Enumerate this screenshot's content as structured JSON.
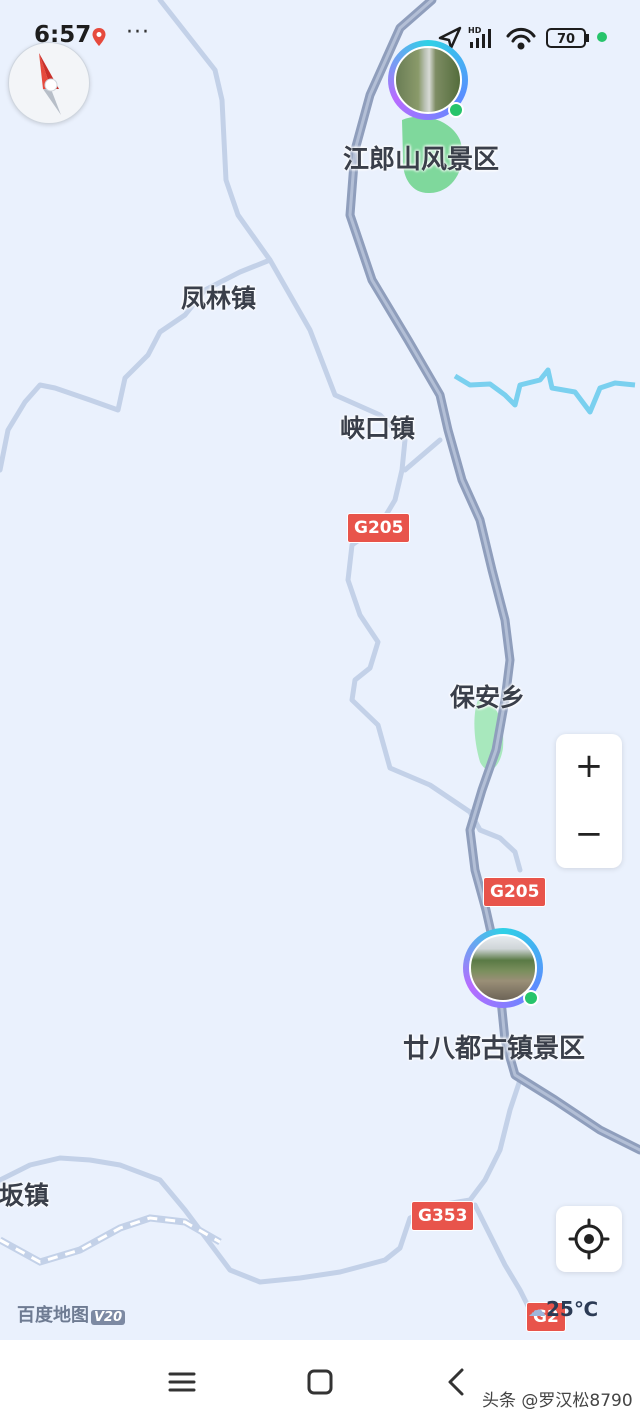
{
  "status_bar": {
    "time": "6:57",
    "more": "···",
    "battery": "70",
    "network": "HD"
  },
  "map": {
    "poi_labels": [
      "江郎山风景区",
      "廿八都古镇景区"
    ],
    "town_labels": [
      "凤林镇",
      "峡口镇",
      "保安乡",
      "坂镇"
    ],
    "road_shields": [
      "G205",
      "G205",
      "G353",
      "G2"
    ]
  },
  "controls": {
    "zoom_in": "+",
    "zoom_out": "−"
  },
  "brand": {
    "name": "百度地图",
    "version": "V20"
  },
  "weather": {
    "temperature": "25℃"
  },
  "watermark": "头条 @罗汉松8790"
}
